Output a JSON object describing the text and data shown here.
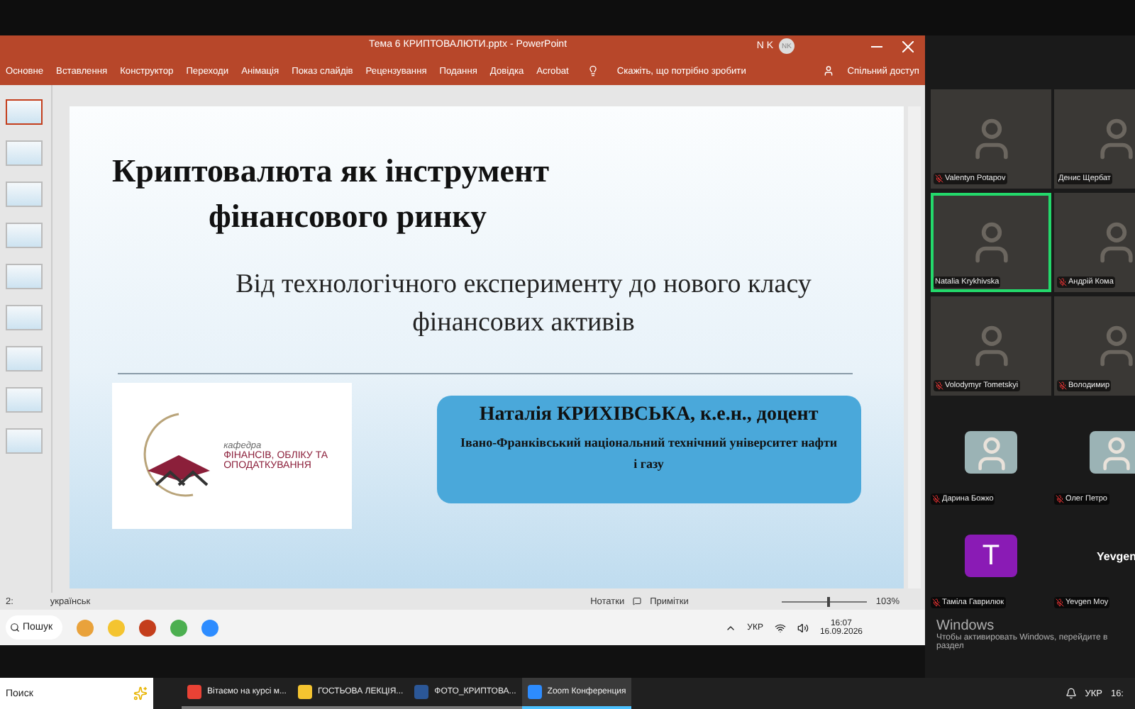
{
  "powerpoint": {
    "title": "Тема 6 КРИПТОВАЛЮТИ.pptx  -  PowerPoint",
    "user_initials": "N K",
    "avatar_initials": "NK",
    "ribbon_tabs": [
      "Основне",
      "Вставлення",
      "Конструктор",
      "Переходи",
      "Анімація",
      "Показ слайдів",
      "Рецензування",
      "Подання",
      "Довідка",
      "Acrobat"
    ],
    "tell_me": "Скажіть, що потрібно зробити",
    "share": "Спільний доступ",
    "thumbnails": [
      {
        "selected": true
      },
      {
        "selected": false
      },
      {
        "selected": false
      },
      {
        "selected": false
      },
      {
        "selected": false
      },
      {
        "selected": false
      },
      {
        "selected": false
      },
      {
        "selected": false
      },
      {
        "selected": false
      }
    ],
    "slide": {
      "title_lines": [
        "Криптовалюта як інструмент",
        "фінансового ринку"
      ],
      "subtitle": "Від технологічного експерименту до нового класу фінансових активів",
      "logo_lines": [
        "кафедра",
        "ФІНАНСІВ, ОБЛІКУ ТА",
        "ОПОДАТКУВАННЯ"
      ],
      "author": "Наталія КРИХІВСЬКА, к.е.н., доцент",
      "affiliation": "Івано-Франківський національний технічний університет нафти і газу"
    },
    "status_bar": {
      "slide_counter": "2:",
      "language": "українськ",
      "notes": "Нотатки",
      "comments": "Примітки",
      "zoom_level": "103%",
      "level": 0.52
    }
  },
  "shared_taskbar": {
    "search": "Пошук",
    "language": "УКР",
    "time": "16:07",
    "date": "16.09.2026"
  },
  "participants": [
    {
      "name": "Valentyn Potapov",
      "kind": "camera",
      "muted": true,
      "speaking": false
    },
    {
      "name": "Денис Щербат",
      "kind": "camera",
      "muted": false,
      "speaking": false
    },
    {
      "name": "Natalia Krykhivska",
      "kind": "camera",
      "muted": false,
      "speaking": true
    },
    {
      "name": "Андрій Кома",
      "kind": "camera",
      "muted": true,
      "speaking": false
    },
    {
      "name": "Volodymyr Tometskyi",
      "kind": "camera",
      "muted": true,
      "speaking": false
    },
    {
      "name": "Володимир",
      "kind": "camera",
      "muted": true,
      "speaking": false
    },
    {
      "name": "Дарина Божко",
      "kind": "photo",
      "muted": true
    },
    {
      "name": "Олег Петро",
      "kind": "photo",
      "muted": true
    },
    {
      "name": "Тамiла Гаврилюк",
      "kind": "initial",
      "initial": "T",
      "color": "#8a1bb5",
      "muted": true
    },
    {
      "name": "Yevgen Моу",
      "kind": "text",
      "display": "Yevgen",
      "muted": true
    }
  ],
  "activation": {
    "title": "Windows",
    "text": "Чтобы активировать Windows, перейдите в раздел"
  },
  "taskbar": {
    "search": "Поиск",
    "apps": [
      {
        "label": "Вітаємо на курсі м...",
        "kind": "browser",
        "selected": false
      },
      {
        "label": "ГОСТЬОВА ЛЕКЦІЯ...",
        "kind": "folder",
        "selected": false
      },
      {
        "label": "ФОТО_КРИПТОВА...",
        "kind": "word",
        "selected": false
      },
      {
        "label": "Zoom Конференция",
        "kind": "zoom",
        "selected": true
      }
    ],
    "language": "УКР",
    "time": "16:"
  }
}
